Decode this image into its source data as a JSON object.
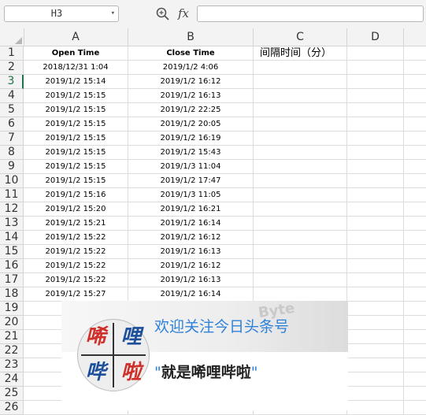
{
  "formula_bar": {
    "name_box": "H3",
    "name_box_arrow": "▾",
    "fx_label": "fx",
    "formula_value": ""
  },
  "columns": [
    "A",
    "B",
    "C",
    "D"
  ],
  "rows": [
    {
      "num": "1",
      "a": "Open Time",
      "b": "Close Time",
      "c": "间隔时间（分）"
    },
    {
      "num": "2",
      "a": "2018/12/31 1:04",
      "b": "2019/1/2 4:06",
      "c": ""
    },
    {
      "num": "3",
      "a": "2019/1/2 15:14",
      "b": "2019/1/2 16:12",
      "c": ""
    },
    {
      "num": "4",
      "a": "2019/1/2 15:15",
      "b": "2019/1/2 16:13",
      "c": ""
    },
    {
      "num": "5",
      "a": "2019/1/2 15:15",
      "b": "2019/1/2 22:25",
      "c": ""
    },
    {
      "num": "6",
      "a": "2019/1/2 15:15",
      "b": "2019/1/2 20:05",
      "c": ""
    },
    {
      "num": "7",
      "a": "2019/1/2 15:15",
      "b": "2019/1/2 16:19",
      "c": ""
    },
    {
      "num": "8",
      "a": "2019/1/2 15:15",
      "b": "2019/1/2 15:43",
      "c": ""
    },
    {
      "num": "9",
      "a": "2019/1/2 15:15",
      "b": "2019/1/3 11:04",
      "c": ""
    },
    {
      "num": "10",
      "a": "2019/1/2 15:15",
      "b": "2019/1/2 17:47",
      "c": ""
    },
    {
      "num": "11",
      "a": "2019/1/2 15:16",
      "b": "2019/1/3 11:05",
      "c": ""
    },
    {
      "num": "12",
      "a": "2019/1/2 15:20",
      "b": "2019/1/2 16:21",
      "c": ""
    },
    {
      "num": "13",
      "a": "2019/1/2 15:21",
      "b": "2019/1/2 16:14",
      "c": ""
    },
    {
      "num": "14",
      "a": "2019/1/2 15:22",
      "b": "2019/1/2 16:12",
      "c": ""
    },
    {
      "num": "15",
      "a": "2019/1/2 15:22",
      "b": "2019/1/2 16:13",
      "c": ""
    },
    {
      "num": "16",
      "a": "2019/1/2 15:22",
      "b": "2019/1/2 16:12",
      "c": ""
    },
    {
      "num": "17",
      "a": "2019/1/2 15:22",
      "b": "2019/1/2 16:13",
      "c": ""
    },
    {
      "num": "18",
      "a": "2019/1/2 15:27",
      "b": "2019/1/2 16:14",
      "c": ""
    },
    {
      "num": "19",
      "a": "",
      "b": "",
      "c": ""
    },
    {
      "num": "20",
      "a": "",
      "b": "",
      "c": ""
    },
    {
      "num": "21",
      "a": "",
      "b": "",
      "c": ""
    },
    {
      "num": "22",
      "a": "",
      "b": "",
      "c": ""
    },
    {
      "num": "23",
      "a": "",
      "b": "",
      "c": ""
    },
    {
      "num": "24",
      "a": "",
      "b": "",
      "c": ""
    },
    {
      "num": "25",
      "a": "",
      "b": "",
      "c": ""
    },
    {
      "num": "26",
      "a": "",
      "b": "",
      "c": ""
    }
  ],
  "selected_cell": "H3",
  "banner": {
    "watermark": "Byte",
    "tagline_top": "欢迎关注今日头条号",
    "open_quote": "\"",
    "tagline_main": "就是唏哩哔啦",
    "close_quote": "\"",
    "logo_chars": [
      "唏",
      "哩",
      "哔",
      "啦"
    ],
    "logo_colors": [
      "#d0302a",
      "#1d4f9c",
      "#1d4f9c",
      "#d0302a"
    ]
  },
  "colors": {
    "accent_green": "#217346",
    "tagline_blue": "#2e82d8"
  }
}
